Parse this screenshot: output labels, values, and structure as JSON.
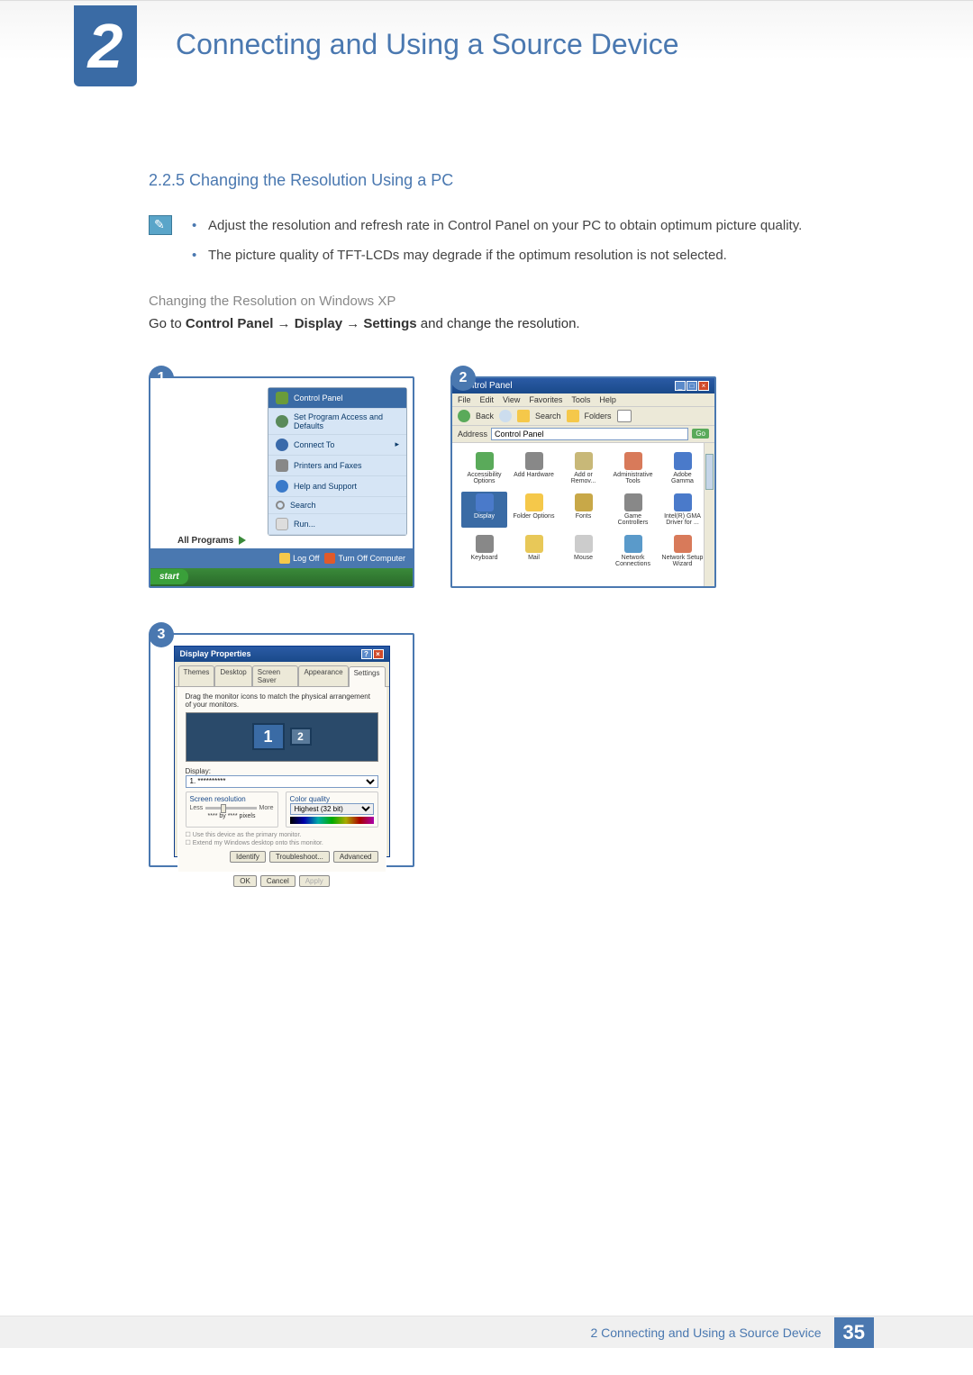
{
  "header": {
    "chapter_number": "2",
    "chapter_title": "Connecting and Using a Source Device"
  },
  "section": {
    "number_title": "2.2.5   Changing the Resolution Using a PC",
    "bullets": [
      "Adjust the resolution and refresh rate in Control Panel on your PC to obtain optimum picture quality.",
      "The picture quality of TFT-LCDs may degrade if the optimum resolution is not selected."
    ],
    "subheading": "Changing the Resolution on Windows XP",
    "instruction_pre": "Go to ",
    "instruction_b1": "Control Panel",
    "instruction_arrow": " → ",
    "instruction_b2": "Display",
    "instruction_b3": "Settings",
    "instruction_post": " and change the resolution."
  },
  "figures": {
    "f1": {
      "badge": "1",
      "items": {
        "control_panel": "Control Panel",
        "set_defaults": "Set Program Access and Defaults",
        "connect_to": "Connect To",
        "printers": "Printers and Faxes",
        "help": "Help and Support",
        "search": "Search",
        "run": "Run..."
      },
      "all_programs": "All Programs",
      "logoff": "Log Off",
      "turnoff": "Turn Off Computer",
      "start": "start"
    },
    "f2": {
      "badge": "2",
      "title": "Control Panel",
      "menu": [
        "File",
        "Edit",
        "View",
        "Favorites",
        "Tools",
        "Help"
      ],
      "toolbar": {
        "back": "Back",
        "search": "Search",
        "folders": "Folders"
      },
      "address_label": "Address",
      "address_value": "Control Panel",
      "go": "Go",
      "icons": [
        "Accessibility Options",
        "Add Hardware",
        "Add or Remov...",
        "Administrative Tools",
        "Adobe Gamma",
        "Display",
        "Folder Options",
        "Fonts",
        "Game Controllers",
        "Intel(R) GMA Driver for ...",
        "Keyboard",
        "Mail",
        "Mouse",
        "Network Connections",
        "Network Setup Wizard"
      ]
    },
    "f3": {
      "badge": "3",
      "title": "Display Properties",
      "tabs": [
        "Themes",
        "Desktop",
        "Screen Saver",
        "Appearance",
        "Settings"
      ],
      "hint": "Drag the monitor icons to match the physical arrangement of your monitors.",
      "mon1": "1",
      "mon2": "2",
      "display_label": "Display:",
      "display_value": "1. **********",
      "screen_res_label": "Screen resolution",
      "less": "Less",
      "more": "More",
      "res_text": "**** by **** pixels",
      "color_label": "Color quality",
      "color_value": "Highest (32 bit)",
      "check1": "Use this device as the primary monitor.",
      "check2": "Extend my Windows desktop onto this monitor.",
      "identify": "Identify",
      "troubleshoot": "Troubleshoot...",
      "advanced": "Advanced",
      "ok": "OK",
      "cancel": "Cancel",
      "apply": "Apply"
    }
  },
  "footer": {
    "text": "2 Connecting and Using a Source Device",
    "page": "35"
  }
}
